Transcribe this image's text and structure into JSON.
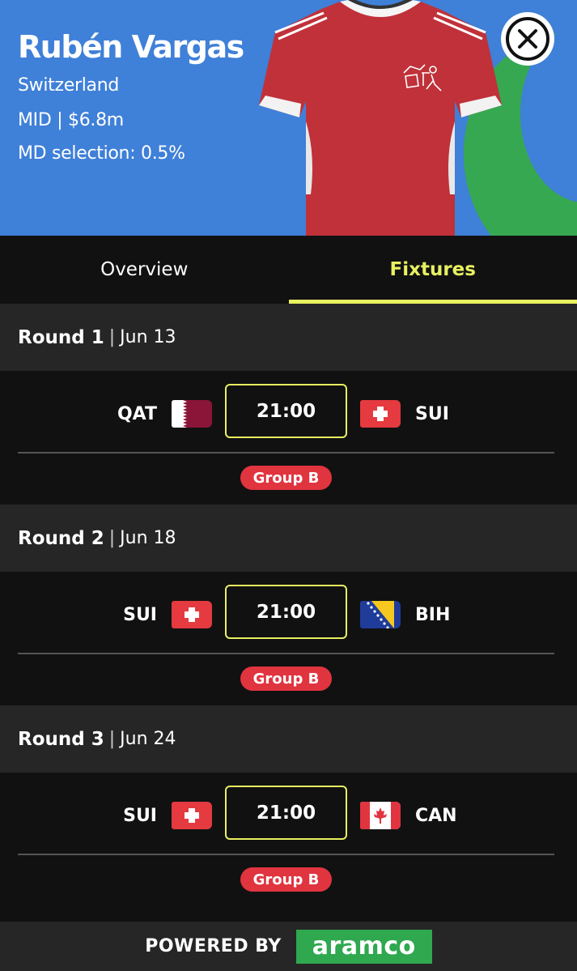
{
  "player": {
    "name": "Rubén Vargas",
    "country": "Switzerland",
    "position_price": "MID | $6.8m",
    "selection": "MD selection: 0.5%"
  },
  "colors": {
    "header_bg": "#3f80d8",
    "accent": "#e8f060",
    "group_pill": "#e0343f",
    "sponsor": "#2fa84f",
    "shirt": "#c0313a"
  },
  "icons": {
    "close": "close-icon",
    "shirt": "jersey-image"
  },
  "tabs": [
    {
      "label": "Overview",
      "active": false
    },
    {
      "label": "Fixtures",
      "active": true
    }
  ],
  "rounds": [
    {
      "name": "Round 1",
      "sep": "|",
      "date": "Jun 13",
      "home": {
        "code": "QAT",
        "flag": "qatar-flag"
      },
      "away": {
        "code": "SUI",
        "flag": "switzerland-flag"
      },
      "time": "21:00",
      "group": "Group B"
    },
    {
      "name": "Round 2",
      "sep": "|",
      "date": "Jun 18",
      "home": {
        "code": "SUI",
        "flag": "switzerland-flag"
      },
      "away": {
        "code": "BIH",
        "flag": "bosnia-flag"
      },
      "time": "21:00",
      "group": "Group B"
    },
    {
      "name": "Round 3",
      "sep": "|",
      "date": "Jun 24",
      "home": {
        "code": "SUI",
        "flag": "switzerland-flag"
      },
      "away": {
        "code": "CAN",
        "flag": "canada-flag"
      },
      "time": "21:00",
      "group": "Group B"
    }
  ],
  "footer": {
    "powered_by": "POWERED BY",
    "sponsor": "aramco"
  }
}
